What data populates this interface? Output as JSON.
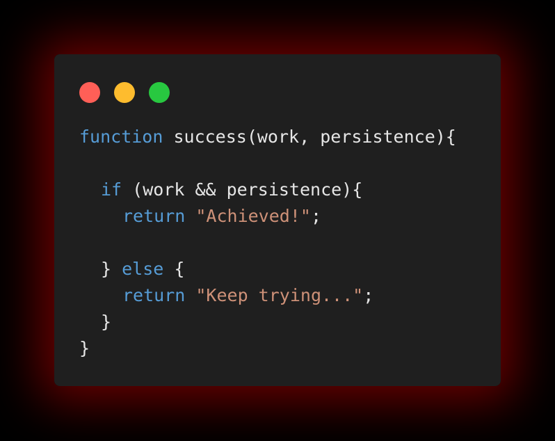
{
  "colors": {
    "background": "#000000",
    "glow": "#8c0000",
    "window": "#1f1f1f",
    "text": "#e6e6e6",
    "keyword": "#569cd6",
    "string": "#ce9178",
    "dot_close": "#ff5f57",
    "dot_minimize": "#febc2e",
    "dot_maximize": "#28c840"
  },
  "window_controls": {
    "close": "close-dot-icon",
    "minimize": "minimize-dot-icon",
    "maximize": "maximize-dot-icon"
  },
  "code": {
    "line1": {
      "kw": "function",
      "rest": " success(work, persistence){"
    },
    "line3": {
      "kw": "if",
      "rest": " (work && persistence){"
    },
    "line4": {
      "kw": "return",
      "sp": " ",
      "str": "\"Achieved!\"",
      "end": ";"
    },
    "line6": {
      "pre": "} ",
      "kw": "else",
      "rest": " {"
    },
    "line7": {
      "kw": "return",
      "sp": " ",
      "str": "\"Keep trying...\"",
      "end": ";"
    },
    "line8": {
      "text": "}"
    },
    "line9": {
      "text": "}"
    }
  }
}
